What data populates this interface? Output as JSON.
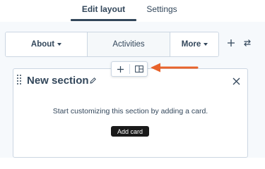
{
  "top_tabs": {
    "items": [
      {
        "label": "Edit layout",
        "active": true
      },
      {
        "label": "Settings",
        "active": false
      }
    ]
  },
  "card_tabs": {
    "items": [
      {
        "label": "About",
        "has_dropdown": true
      },
      {
        "label": "Activities",
        "has_dropdown": false
      },
      {
        "label": "More",
        "has_dropdown": true
      }
    ],
    "icons": [
      "plus-icon",
      "swap-icon"
    ]
  },
  "section": {
    "title": "New section",
    "message": "Start customizing this section by adding a card.",
    "add_card_label": "Add card",
    "icons": [
      "drag-handle-icon",
      "pencil-icon",
      "close-icon"
    ]
  },
  "floating_toolbar": {
    "icons": [
      "plus-icon",
      "layout-icon"
    ]
  },
  "colors": {
    "text": "#33475b",
    "border": "#cbd6e2",
    "button_bg": "#1a1a1a",
    "annotation_arrow": "#e8632b"
  }
}
